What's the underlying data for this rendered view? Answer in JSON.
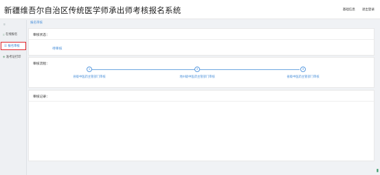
{
  "header": {
    "title": "新疆维吾尔自治区传统医学师承出师考核报名系统",
    "links": [
      "基础信息",
      "退出登录"
    ]
  },
  "sidebar": {
    "collapse_icon": "≡",
    "items": [
      {
        "icon": "≡",
        "label": "在线报名"
      },
      {
        "icon": "☰",
        "label": "报名审核"
      },
      {
        "icon": "◈",
        "label": "准考证打印"
      }
    ]
  },
  "tab": "报名审核",
  "audit_status": {
    "title": "审核状态：",
    "value": "待审核"
  },
  "audit_flow": {
    "title": "审核流程：",
    "steps": [
      {
        "number": "1",
        "label": "县级中医药主管部门审核"
      },
      {
        "number": "2",
        "label": "地州级中医药主管部门审核"
      },
      {
        "number": "3",
        "label": "省级中医药主管部门审核"
      }
    ]
  },
  "audit_record": {
    "title": "审核记录："
  },
  "colors": {
    "accent": "#4a90d9",
    "highlight": "#e0262b"
  }
}
